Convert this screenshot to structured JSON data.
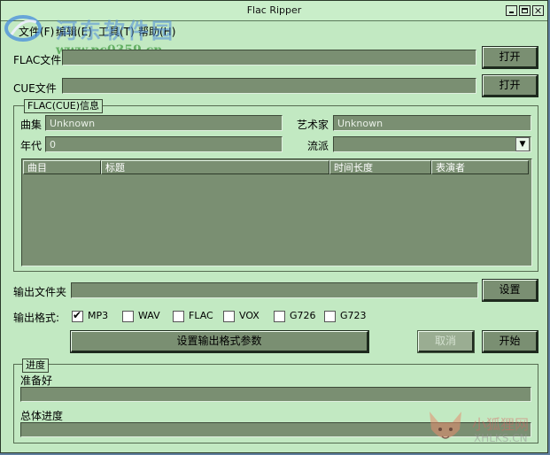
{
  "window": {
    "title": "Flac Ripper"
  },
  "watermark": {
    "site_name": "河东软件园",
    "url": "www.pc0359.cn",
    "corner_cn": "小狐狸网",
    "corner_en": "XHLKS.CN"
  },
  "menu": {
    "items": [
      "文件(F)",
      "编辑(E)",
      "工具(T)",
      "帮助(H)"
    ]
  },
  "flac_file": {
    "label": "FLAC文件",
    "value": "",
    "button": "打开"
  },
  "cue_file": {
    "label": "CUE文件",
    "value": "",
    "button": "打开"
  },
  "info_group": {
    "title": "FLAC(CUE)信息",
    "album_label": "曲集",
    "album_value": "Unknown",
    "artist_label": "艺术家",
    "artist_value": "Unknown",
    "year_label": "年代",
    "year_value": "0",
    "genre_label": "流派",
    "genre_value": "",
    "columns": [
      "曲目",
      "标题",
      "时间长度",
      "表演者"
    ]
  },
  "output": {
    "folder_label": "输出文件夹",
    "folder_value": "",
    "settings_button": "设置",
    "format_label": "输出格式:",
    "formats": [
      {
        "name": "MP3",
        "checked": true
      },
      {
        "name": "WAV",
        "checked": false
      },
      {
        "name": "FLAC",
        "checked": false
      },
      {
        "name": "VOX",
        "checked": false
      },
      {
        "name": "G726",
        "checked": false
      },
      {
        "name": "G723",
        "checked": false
      }
    ],
    "format_params_button": "设置输出格式参数",
    "cancel_button": "取消",
    "start_button": "开始"
  },
  "progress": {
    "title": "进度",
    "status_label": "准备好",
    "overall_label": "总体进度",
    "current_value": 0,
    "overall_value": 0
  }
}
